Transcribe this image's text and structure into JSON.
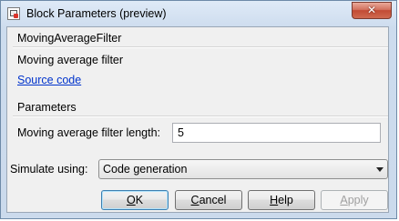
{
  "window": {
    "title": "Block Parameters (preview)",
    "close_label": "✕"
  },
  "block": {
    "name": "MovingAverageFilter",
    "description": "Moving average filter",
    "source_link": "Source code"
  },
  "parameters": {
    "header": "Parameters",
    "filter_length_label": "Moving average filter length:",
    "filter_length_value": "5"
  },
  "simulate": {
    "label": "Simulate using:",
    "selected": "Code generation"
  },
  "buttons": {
    "ok": {
      "label": "OK",
      "underline": "O",
      "rest": "K"
    },
    "cancel": {
      "label": "Cancel",
      "underline": "C",
      "rest": "ancel"
    },
    "help": {
      "label": "Help",
      "underline": "H",
      "rest": "elp"
    },
    "apply": {
      "label": "Apply",
      "underline": "A",
      "rest": "pply"
    }
  }
}
